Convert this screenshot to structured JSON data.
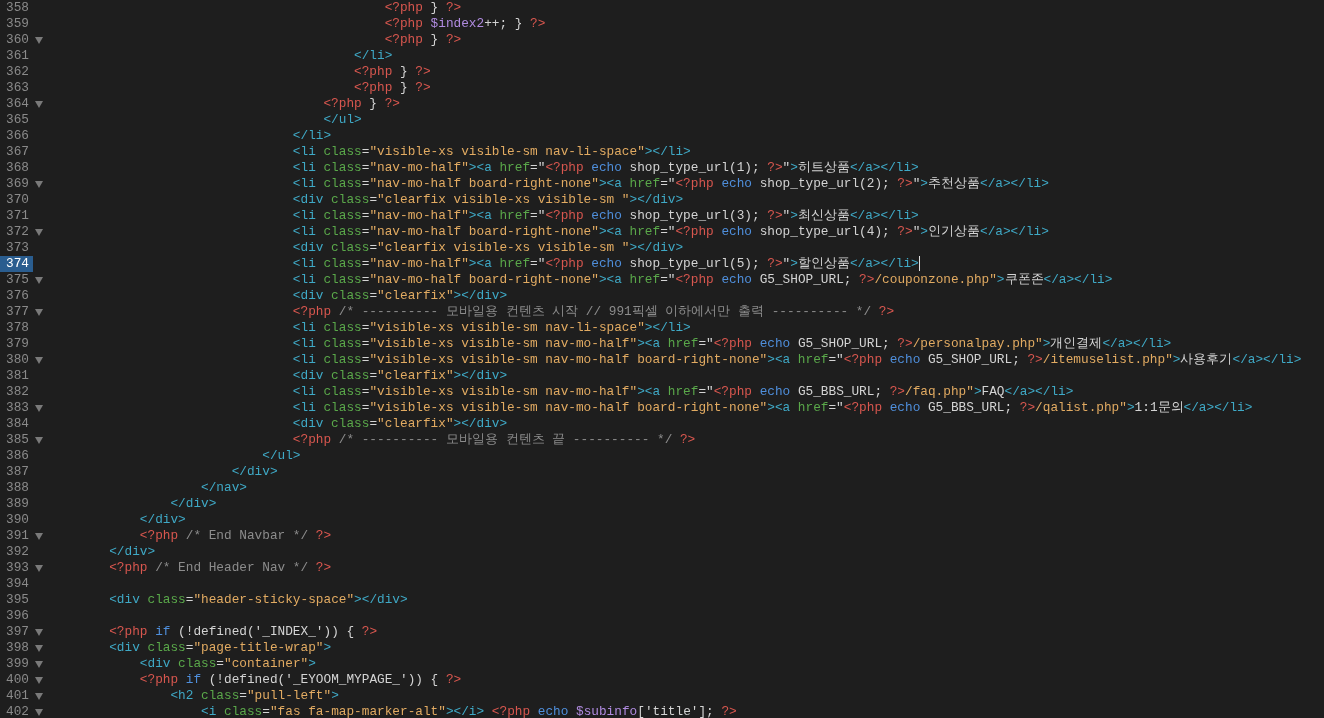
{
  "editor": {
    "lines": [
      {
        "number": "358",
        "fold": false,
        "current": false,
        "tokens": [
          {
            "kind": "php",
            "text": "                                            <?php"
          },
          {
            "kind": "txt",
            "text": " } "
          },
          {
            "kind": "php",
            "text": "?>"
          }
        ]
      },
      {
        "number": "359",
        "fold": false,
        "current": false,
        "tokens": [
          {
            "kind": "php",
            "text": "                                            <?php "
          },
          {
            "kind": "var",
            "text": "$index2"
          },
          {
            "kind": "txt",
            "text": "++; } "
          },
          {
            "kind": "php",
            "text": "?>"
          }
        ]
      },
      {
        "number": "360",
        "fold": true,
        "current": false,
        "tokens": [
          {
            "kind": "php",
            "text": "                                            <?php"
          },
          {
            "kind": "txt",
            "text": " } "
          },
          {
            "kind": "php",
            "text": "?>"
          }
        ]
      },
      {
        "number": "361",
        "fold": false,
        "current": false,
        "tokens": [
          {
            "kind": "tag",
            "text": "                                        </li>"
          }
        ]
      },
      {
        "number": "362",
        "fold": false,
        "current": false,
        "tokens": [
          {
            "kind": "php",
            "text": "                                        <?php"
          },
          {
            "kind": "txt",
            "text": " } "
          },
          {
            "kind": "php",
            "text": "?>"
          }
        ]
      },
      {
        "number": "363",
        "fold": false,
        "current": false,
        "tokens": [
          {
            "kind": "php",
            "text": "                                        <?php"
          },
          {
            "kind": "txt",
            "text": " } "
          },
          {
            "kind": "php",
            "text": "?>"
          }
        ]
      },
      {
        "number": "364",
        "fold": true,
        "current": false,
        "tokens": [
          {
            "kind": "php",
            "text": "                                    <?php"
          },
          {
            "kind": "txt",
            "text": " } "
          },
          {
            "kind": "php",
            "text": "?>"
          }
        ]
      },
      {
        "number": "365",
        "fold": false,
        "current": false,
        "tokens": [
          {
            "kind": "tag",
            "text": "                                    </ul>"
          }
        ]
      },
      {
        "number": "366",
        "fold": false,
        "current": false,
        "tokens": [
          {
            "kind": "tag",
            "text": "                                </li>"
          }
        ]
      },
      {
        "number": "367",
        "fold": false,
        "current": false,
        "tokens": [
          {
            "kind": "tag",
            "text": "                                <li "
          },
          {
            "kind": "attr",
            "text": "class"
          },
          {
            "kind": "txt",
            "text": "="
          },
          {
            "kind": "str",
            "text": "\"visible-xs visible-sm nav-li-space\""
          },
          {
            "kind": "tag",
            "text": "></li>"
          }
        ]
      },
      {
        "number": "368",
        "fold": false,
        "current": false,
        "tokens": [
          {
            "kind": "tag",
            "text": "                                <li "
          },
          {
            "kind": "attr",
            "text": "class"
          },
          {
            "kind": "txt",
            "text": "="
          },
          {
            "kind": "str",
            "text": "\"nav-mo-half\""
          },
          {
            "kind": "tag",
            "text": "><a "
          },
          {
            "kind": "attr",
            "text": "href"
          },
          {
            "kind": "txt",
            "text": "=\""
          },
          {
            "kind": "php",
            "text": "<?php "
          },
          {
            "kind": "kw",
            "text": "echo"
          },
          {
            "kind": "txt",
            "text": " shop_type_url(1); "
          },
          {
            "kind": "php",
            "text": "?>"
          },
          {
            "kind": "txt",
            "text": "\""
          },
          {
            "kind": "tag",
            "text": ">"
          },
          {
            "kind": "txt",
            "text": "히트상품"
          },
          {
            "kind": "tag",
            "text": "</a></li>"
          }
        ]
      },
      {
        "number": "369",
        "fold": true,
        "current": false,
        "tokens": [
          {
            "kind": "tag",
            "text": "                                <li "
          },
          {
            "kind": "attr",
            "text": "class"
          },
          {
            "kind": "txt",
            "text": "="
          },
          {
            "kind": "str",
            "text": "\"nav-mo-half board-right-none\""
          },
          {
            "kind": "tag",
            "text": "><a "
          },
          {
            "kind": "attr",
            "text": "href"
          },
          {
            "kind": "txt",
            "text": "=\""
          },
          {
            "kind": "php",
            "text": "<?php "
          },
          {
            "kind": "kw",
            "text": "echo"
          },
          {
            "kind": "txt",
            "text": " shop_type_url(2); "
          },
          {
            "kind": "php",
            "text": "?>"
          },
          {
            "kind": "txt",
            "text": "\""
          },
          {
            "kind": "tag",
            "text": ">"
          },
          {
            "kind": "txt",
            "text": "추천상품"
          },
          {
            "kind": "tag",
            "text": "</a></li>"
          }
        ]
      },
      {
        "number": "370",
        "fold": false,
        "current": false,
        "tokens": [
          {
            "kind": "tag",
            "text": "                                <div "
          },
          {
            "kind": "attr",
            "text": "class"
          },
          {
            "kind": "txt",
            "text": "="
          },
          {
            "kind": "str",
            "text": "\"clearfix visible-xs visible-sm \""
          },
          {
            "kind": "tag",
            "text": "></div>"
          }
        ]
      },
      {
        "number": "371",
        "fold": false,
        "current": false,
        "tokens": [
          {
            "kind": "tag",
            "text": "                                <li "
          },
          {
            "kind": "attr",
            "text": "class"
          },
          {
            "kind": "txt",
            "text": "="
          },
          {
            "kind": "str",
            "text": "\"nav-mo-half\""
          },
          {
            "kind": "tag",
            "text": "><a "
          },
          {
            "kind": "attr",
            "text": "href"
          },
          {
            "kind": "txt",
            "text": "=\""
          },
          {
            "kind": "php",
            "text": "<?php "
          },
          {
            "kind": "kw",
            "text": "echo"
          },
          {
            "kind": "txt",
            "text": " shop_type_url(3); "
          },
          {
            "kind": "php",
            "text": "?>"
          },
          {
            "kind": "txt",
            "text": "\""
          },
          {
            "kind": "tag",
            "text": ">"
          },
          {
            "kind": "txt",
            "text": "최신상품"
          },
          {
            "kind": "tag",
            "text": "</a></li>"
          }
        ]
      },
      {
        "number": "372",
        "fold": true,
        "current": false,
        "tokens": [
          {
            "kind": "tag",
            "text": "                                <li "
          },
          {
            "kind": "attr",
            "text": "class"
          },
          {
            "kind": "txt",
            "text": "="
          },
          {
            "kind": "str",
            "text": "\"nav-mo-half board-right-none\""
          },
          {
            "kind": "tag",
            "text": "><a "
          },
          {
            "kind": "attr",
            "text": "href"
          },
          {
            "kind": "txt",
            "text": "=\""
          },
          {
            "kind": "php",
            "text": "<?php "
          },
          {
            "kind": "kw",
            "text": "echo"
          },
          {
            "kind": "txt",
            "text": " shop_type_url(4); "
          },
          {
            "kind": "php",
            "text": "?>"
          },
          {
            "kind": "txt",
            "text": "\""
          },
          {
            "kind": "tag",
            "text": ">"
          },
          {
            "kind": "txt",
            "text": "인기상품"
          },
          {
            "kind": "tag",
            "text": "</a></li>"
          }
        ]
      },
      {
        "number": "373",
        "fold": false,
        "current": false,
        "tokens": [
          {
            "kind": "tag",
            "text": "                                <div "
          },
          {
            "kind": "attr",
            "text": "class"
          },
          {
            "kind": "txt",
            "text": "="
          },
          {
            "kind": "str",
            "text": "\"clearfix visible-xs visible-sm \""
          },
          {
            "kind": "tag",
            "text": "></div>"
          }
        ]
      },
      {
        "number": "374",
        "fold": false,
        "current": true,
        "tokens": [
          {
            "kind": "tag",
            "text": "                                <li "
          },
          {
            "kind": "attr",
            "text": "class"
          },
          {
            "kind": "txt",
            "text": "="
          },
          {
            "kind": "str",
            "text": "\"nav-mo-half\""
          },
          {
            "kind": "tag",
            "text": "><a "
          },
          {
            "kind": "attr",
            "text": "href"
          },
          {
            "kind": "txt",
            "text": "=\""
          },
          {
            "kind": "php",
            "text": "<?php "
          },
          {
            "kind": "kw",
            "text": "echo"
          },
          {
            "kind": "txt",
            "text": " shop_type_url(5); "
          },
          {
            "kind": "php",
            "text": "?>"
          },
          {
            "kind": "txt",
            "text": "\""
          },
          {
            "kind": "tag",
            "text": ">"
          },
          {
            "kind": "txt",
            "text": "할인상품"
          },
          {
            "kind": "tag",
            "text": "</a></li>"
          }
        ]
      },
      {
        "number": "375",
        "fold": true,
        "current": false,
        "tokens": [
          {
            "kind": "tag",
            "text": "                                <li "
          },
          {
            "kind": "attr",
            "text": "class"
          },
          {
            "kind": "txt",
            "text": "="
          },
          {
            "kind": "str",
            "text": "\"nav-mo-half board-right-none\""
          },
          {
            "kind": "tag",
            "text": "><a "
          },
          {
            "kind": "attr",
            "text": "href"
          },
          {
            "kind": "txt",
            "text": "=\""
          },
          {
            "kind": "php",
            "text": "<?php "
          },
          {
            "kind": "kw",
            "text": "echo"
          },
          {
            "kind": "txt",
            "text": " G5_SHOP_URL; "
          },
          {
            "kind": "php",
            "text": "?>"
          },
          {
            "kind": "str",
            "text": "/couponzone.php\""
          },
          {
            "kind": "tag",
            "text": ">"
          },
          {
            "kind": "txt",
            "text": "쿠폰존"
          },
          {
            "kind": "tag",
            "text": "</a></li>"
          }
        ]
      },
      {
        "number": "376",
        "fold": false,
        "current": false,
        "tokens": [
          {
            "kind": "tag",
            "text": "                                <div "
          },
          {
            "kind": "attr",
            "text": "class"
          },
          {
            "kind": "txt",
            "text": "="
          },
          {
            "kind": "str",
            "text": "\"clearfix\""
          },
          {
            "kind": "tag",
            "text": "></div>"
          }
        ]
      },
      {
        "number": "377",
        "fold": true,
        "current": false,
        "tokens": [
          {
            "kind": "php",
            "text": "                                <?php "
          },
          {
            "kind": "cmt",
            "text": "/* ---------- 모바일용 컨텐츠 시작 // 991픽셀 이하에서만 출력 ---------- */ "
          },
          {
            "kind": "php",
            "text": "?>"
          }
        ]
      },
      {
        "number": "378",
        "fold": false,
        "current": false,
        "tokens": [
          {
            "kind": "tag",
            "text": "                                <li "
          },
          {
            "kind": "attr",
            "text": "class"
          },
          {
            "kind": "txt",
            "text": "="
          },
          {
            "kind": "str",
            "text": "\"visible-xs visible-sm nav-li-space\""
          },
          {
            "kind": "tag",
            "text": "></li>"
          }
        ]
      },
      {
        "number": "379",
        "fold": false,
        "current": false,
        "tokens": [
          {
            "kind": "tag",
            "text": "                                <li "
          },
          {
            "kind": "attr",
            "text": "class"
          },
          {
            "kind": "txt",
            "text": "="
          },
          {
            "kind": "str",
            "text": "\"visible-xs visible-sm nav-mo-half\""
          },
          {
            "kind": "tag",
            "text": "><a "
          },
          {
            "kind": "attr",
            "text": "href"
          },
          {
            "kind": "txt",
            "text": "=\""
          },
          {
            "kind": "php",
            "text": "<?php "
          },
          {
            "kind": "kw",
            "text": "echo"
          },
          {
            "kind": "txt",
            "text": " G5_SHOP_URL; "
          },
          {
            "kind": "php",
            "text": "?>"
          },
          {
            "kind": "str",
            "text": "/personalpay.php\""
          },
          {
            "kind": "tag",
            "text": ">"
          },
          {
            "kind": "txt",
            "text": "개인결제"
          },
          {
            "kind": "tag",
            "text": "</a></li>"
          }
        ]
      },
      {
        "number": "380",
        "fold": true,
        "current": false,
        "tokens": [
          {
            "kind": "tag",
            "text": "                                <li "
          },
          {
            "kind": "attr",
            "text": "class"
          },
          {
            "kind": "txt",
            "text": "="
          },
          {
            "kind": "str",
            "text": "\"visible-xs visible-sm nav-mo-half board-right-none\""
          },
          {
            "kind": "tag",
            "text": "><a "
          },
          {
            "kind": "attr",
            "text": "href"
          },
          {
            "kind": "txt",
            "text": "=\""
          },
          {
            "kind": "php",
            "text": "<?php "
          },
          {
            "kind": "kw",
            "text": "echo"
          },
          {
            "kind": "txt",
            "text": " G5_SHOP_URL; "
          },
          {
            "kind": "php",
            "text": "?>"
          },
          {
            "kind": "str",
            "text": "/itemuselist.php\""
          },
          {
            "kind": "tag",
            "text": ">"
          },
          {
            "kind": "txt",
            "text": "사용후기"
          },
          {
            "kind": "tag",
            "text": "</a></li>"
          }
        ]
      },
      {
        "number": "381",
        "fold": false,
        "current": false,
        "tokens": [
          {
            "kind": "tag",
            "text": "                                <div "
          },
          {
            "kind": "attr",
            "text": "class"
          },
          {
            "kind": "txt",
            "text": "="
          },
          {
            "kind": "str",
            "text": "\"clearfix\""
          },
          {
            "kind": "tag",
            "text": "></div>"
          }
        ]
      },
      {
        "number": "382",
        "fold": false,
        "current": false,
        "tokens": [
          {
            "kind": "tag",
            "text": "                                <li "
          },
          {
            "kind": "attr",
            "text": "class"
          },
          {
            "kind": "txt",
            "text": "="
          },
          {
            "kind": "str",
            "text": "\"visible-xs visible-sm nav-mo-half\""
          },
          {
            "kind": "tag",
            "text": "><a "
          },
          {
            "kind": "attr",
            "text": "href"
          },
          {
            "kind": "txt",
            "text": "=\""
          },
          {
            "kind": "php",
            "text": "<?php "
          },
          {
            "kind": "kw",
            "text": "echo"
          },
          {
            "kind": "txt",
            "text": " G5_BBS_URL; "
          },
          {
            "kind": "php",
            "text": "?>"
          },
          {
            "kind": "str",
            "text": "/faq.php\""
          },
          {
            "kind": "tag",
            "text": ">"
          },
          {
            "kind": "txt",
            "text": "FAQ"
          },
          {
            "kind": "tag",
            "text": "</a></li>"
          }
        ]
      },
      {
        "number": "383",
        "fold": true,
        "current": false,
        "tokens": [
          {
            "kind": "tag",
            "text": "                                <li "
          },
          {
            "kind": "attr",
            "text": "class"
          },
          {
            "kind": "txt",
            "text": "="
          },
          {
            "kind": "str",
            "text": "\"visible-xs visible-sm nav-mo-half board-right-none\""
          },
          {
            "kind": "tag",
            "text": "><a "
          },
          {
            "kind": "attr",
            "text": "href"
          },
          {
            "kind": "txt",
            "text": "=\""
          },
          {
            "kind": "php",
            "text": "<?php "
          },
          {
            "kind": "kw",
            "text": "echo"
          },
          {
            "kind": "txt",
            "text": " G5_BBS_URL; "
          },
          {
            "kind": "php",
            "text": "?>"
          },
          {
            "kind": "str",
            "text": "/qalist.php\""
          },
          {
            "kind": "tag",
            "text": ">"
          },
          {
            "kind": "txt",
            "text": "1:1문의"
          },
          {
            "kind": "tag",
            "text": "</a></li>"
          }
        ]
      },
      {
        "number": "384",
        "fold": false,
        "current": false,
        "tokens": [
          {
            "kind": "tag",
            "text": "                                <div "
          },
          {
            "kind": "attr",
            "text": "class"
          },
          {
            "kind": "txt",
            "text": "="
          },
          {
            "kind": "str",
            "text": "\"clearfix\""
          },
          {
            "kind": "tag",
            "text": "></div>"
          }
        ]
      },
      {
        "number": "385",
        "fold": true,
        "current": false,
        "tokens": [
          {
            "kind": "php",
            "text": "                                <?php "
          },
          {
            "kind": "cmt",
            "text": "/* ---------- 모바일용 컨텐츠 끝 ---------- */ "
          },
          {
            "kind": "php",
            "text": "?>"
          }
        ]
      },
      {
        "number": "386",
        "fold": false,
        "current": false,
        "tokens": [
          {
            "kind": "tag",
            "text": "                            </ul>"
          }
        ]
      },
      {
        "number": "387",
        "fold": false,
        "current": false,
        "tokens": [
          {
            "kind": "tag",
            "text": "                        </div>"
          }
        ]
      },
      {
        "number": "388",
        "fold": false,
        "current": false,
        "tokens": [
          {
            "kind": "tag",
            "text": "                    </nav>"
          }
        ]
      },
      {
        "number": "389",
        "fold": false,
        "current": false,
        "tokens": [
          {
            "kind": "tag",
            "text": "                </div>"
          }
        ]
      },
      {
        "number": "390",
        "fold": false,
        "current": false,
        "tokens": [
          {
            "kind": "tag",
            "text": "            </div>"
          }
        ]
      },
      {
        "number": "391",
        "fold": true,
        "current": false,
        "tokens": [
          {
            "kind": "php",
            "text": "            <?php "
          },
          {
            "kind": "cmt",
            "text": "/* End Navbar */ "
          },
          {
            "kind": "php",
            "text": "?>"
          }
        ]
      },
      {
        "number": "392",
        "fold": false,
        "current": false,
        "tokens": [
          {
            "kind": "tag",
            "text": "        </div>"
          }
        ]
      },
      {
        "number": "393",
        "fold": true,
        "current": false,
        "tokens": [
          {
            "kind": "php",
            "text": "        <?php "
          },
          {
            "kind": "cmt",
            "text": "/* End Header Nav */ "
          },
          {
            "kind": "php",
            "text": "?>"
          }
        ]
      },
      {
        "number": "394",
        "fold": false,
        "current": false
      },
      {
        "number": "395",
        "fold": false,
        "current": false,
        "tokens": [
          {
            "kind": "tag",
            "text": "        <div "
          },
          {
            "kind": "attr",
            "text": "class"
          },
          {
            "kind": "txt",
            "text": "="
          },
          {
            "kind": "str",
            "text": "\"header-sticky-space\""
          },
          {
            "kind": "tag",
            "text": "></div>"
          }
        ]
      },
      {
        "number": "396",
        "fold": false,
        "current": false
      },
      {
        "number": "397",
        "fold": true,
        "current": false,
        "tokens": [
          {
            "kind": "php",
            "text": "        <?php "
          },
          {
            "kind": "kw",
            "text": "if"
          },
          {
            "kind": "txt",
            "text": " (!defined('_INDEX_')) { "
          },
          {
            "kind": "php",
            "text": "?>"
          }
        ]
      },
      {
        "number": "398",
        "fold": true,
        "current": false,
        "tokens": [
          {
            "kind": "tag",
            "text": "        <div "
          },
          {
            "kind": "attr",
            "text": "class"
          },
          {
            "kind": "txt",
            "text": "="
          },
          {
            "kind": "str",
            "text": "\"page-title-wrap\""
          },
          {
            "kind": "tag",
            "text": ">"
          }
        ]
      },
      {
        "number": "399",
        "fold": true,
        "current": false,
        "tokens": [
          {
            "kind": "tag",
            "text": "            <div "
          },
          {
            "kind": "attr",
            "text": "class"
          },
          {
            "kind": "txt",
            "text": "="
          },
          {
            "kind": "str",
            "text": "\"container\""
          },
          {
            "kind": "tag",
            "text": ">"
          }
        ]
      },
      {
        "number": "400",
        "fold": true,
        "current": false,
        "tokens": [
          {
            "kind": "php",
            "text": "            <?php "
          },
          {
            "kind": "kw",
            "text": "if"
          },
          {
            "kind": "txt",
            "text": " (!defined('_EYOOM_MYPAGE_')) { "
          },
          {
            "kind": "php",
            "text": "?>"
          }
        ]
      },
      {
        "number": "401",
        "fold": true,
        "current": false,
        "tokens": [
          {
            "kind": "tag",
            "text": "                <h2 "
          },
          {
            "kind": "attr",
            "text": "class"
          },
          {
            "kind": "txt",
            "text": "="
          },
          {
            "kind": "str",
            "text": "\"pull-left\""
          },
          {
            "kind": "tag",
            "text": ">"
          }
        ]
      },
      {
        "number": "402",
        "fold": true,
        "current": false,
        "tokens": [
          {
            "kind": "tag",
            "text": "                    <i "
          },
          {
            "kind": "attr",
            "text": "class"
          },
          {
            "kind": "txt",
            "text": "="
          },
          {
            "kind": "str",
            "text": "\"fas fa-map-marker-alt\""
          },
          {
            "kind": "tag",
            "text": "></i> "
          },
          {
            "kind": "php",
            "text": "<?php "
          },
          {
            "kind": "kw",
            "text": "echo "
          },
          {
            "kind": "var",
            "text": "$subinfo"
          },
          {
            "kind": "txt",
            "text": "['title']; "
          },
          {
            "kind": "php",
            "text": "?>"
          }
        ]
      }
    ]
  }
}
